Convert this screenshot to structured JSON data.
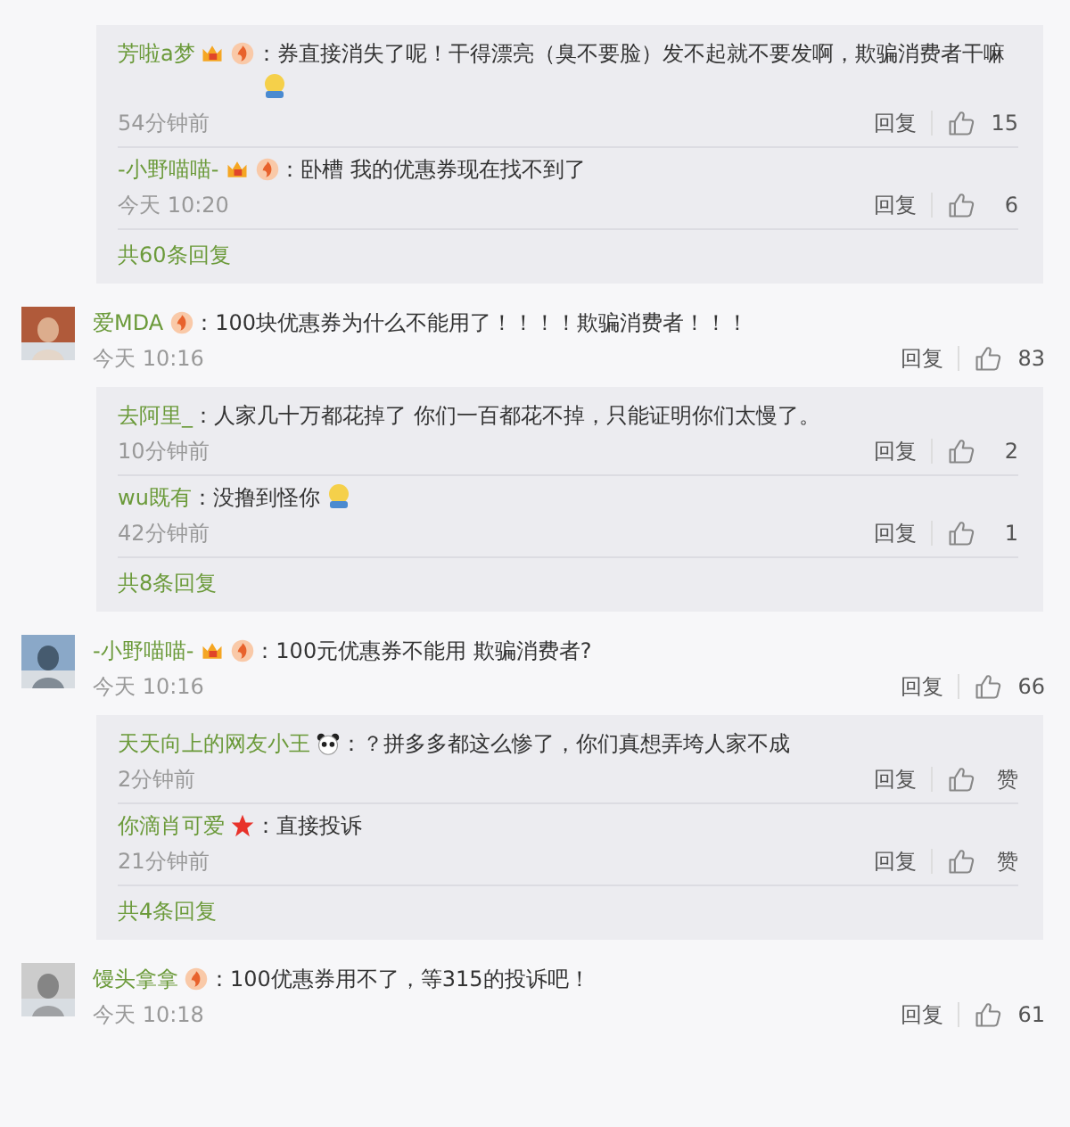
{
  "threads": [
    {
      "replies": [
        {
          "name": "芳啦a梦",
          "badges": [
            {
              "kind": "member"
            },
            {
              "kind": "level"
            }
          ],
          "text": "：券直接消失了呢！干得漂亮（臭不要脸）发不起就不要发啊，欺骗消费者干嘛",
          "emoji": true,
          "time": "54分钟前",
          "reply": "回复",
          "likes": "15"
        },
        {
          "name": "-小野喵喵-",
          "badges": [
            {
              "kind": "member"
            },
            {
              "kind": "level"
            }
          ],
          "text": "：卧槽 我的优惠券现在找不到了",
          "emoji": false,
          "time": "今天 10:20",
          "reply": "回复",
          "likes": "6"
        }
      ],
      "more": "共60条回复"
    },
    {
      "comment": {
        "name": "爱MDA",
        "badges": [
          {
            "kind": "level"
          }
        ],
        "text": "：100块优惠券为什么不能用了！！！！欺骗消费者！！！",
        "time": "今天 10:16",
        "reply": "回复",
        "likes": "83"
      },
      "replies": [
        {
          "name": "去阿里_",
          "text": "：人家几十万都花掉了  你们一百都花不掉，只能证明你们太慢了。",
          "emoji": false,
          "time": "10分钟前",
          "reply": "回复",
          "likes": "2"
        },
        {
          "name": "wu既有",
          "text": "：没撸到怪你",
          "emoji": true,
          "time": "42分钟前",
          "reply": "回复",
          "likes": "1"
        }
      ],
      "more": "共8条回复"
    },
    {
      "comment": {
        "name": "-小野喵喵-",
        "badges": [
          {
            "kind": "member"
          },
          {
            "kind": "level"
          }
        ],
        "text": "：100元优惠券不能用 欺骗消费者?",
        "time": "今天 10:16",
        "reply": "回复",
        "likes": "66"
      },
      "replies": [
        {
          "name": "天天向上的网友小王",
          "badges": [
            {
              "kind": "panda"
            }
          ],
          "text": "：？拼多多都这么惨了，你们真想弄垮人家不成",
          "emoji": false,
          "time": "2分钟前",
          "reply": "回复",
          "likes": "赞"
        },
        {
          "name": "你滴肖可爱",
          "badges": [
            {
              "kind": "star"
            }
          ],
          "text": "：直接投诉",
          "emoji": false,
          "time": "21分钟前",
          "reply": "回复",
          "likes": "赞"
        }
      ],
      "more": "共4条回复"
    },
    {
      "comment": {
        "name": "馒头拿拿",
        "badges": [
          {
            "kind": "level"
          }
        ],
        "text": "：100优惠券用不了，等315的投诉吧！",
        "time": "今天 10:18",
        "reply": "回复",
        "likes": "61"
      }
    }
  ]
}
